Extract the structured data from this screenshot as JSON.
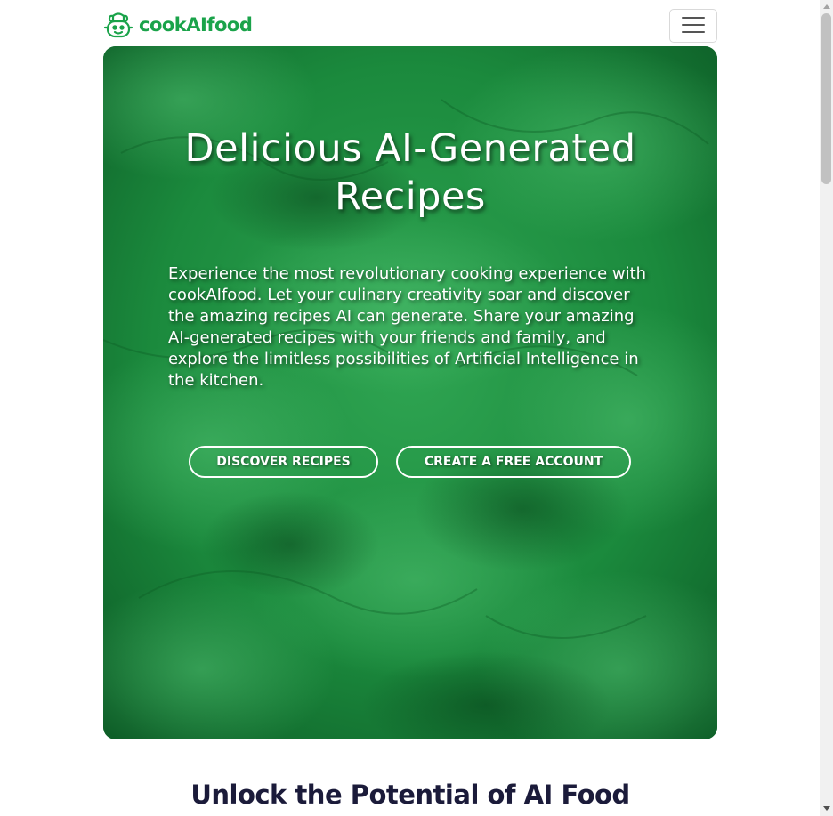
{
  "brand": {
    "name": "cookAIfood",
    "logo_icon": "chef-robot-icon",
    "color": "#1aa34a"
  },
  "navbar": {
    "toggler_icon": "hamburger-menu-icon"
  },
  "hero": {
    "title": "Delicious AI-Generated Recipes",
    "description": "Experience the most revolutionary cooking experience with cookAIfood. Let your culinary creativity soar and discover the amazing recipes AI can generate. Share your amazing AI-generated recipes with your friends and family, and explore the limitless possibilities of Artificial Intelligence in the kitchen.",
    "buttons": {
      "discover": "DISCOVER RECIPES",
      "create_account": "CREATE A FREE ACCOUNT"
    },
    "background": "parsley-leaves-image",
    "background_color": "#1a8a3e"
  },
  "section": {
    "title": "Unlock the Potential of AI Food"
  },
  "colors": {
    "heading": "#1b1b3a",
    "text_on_hero": "#ffffff"
  }
}
